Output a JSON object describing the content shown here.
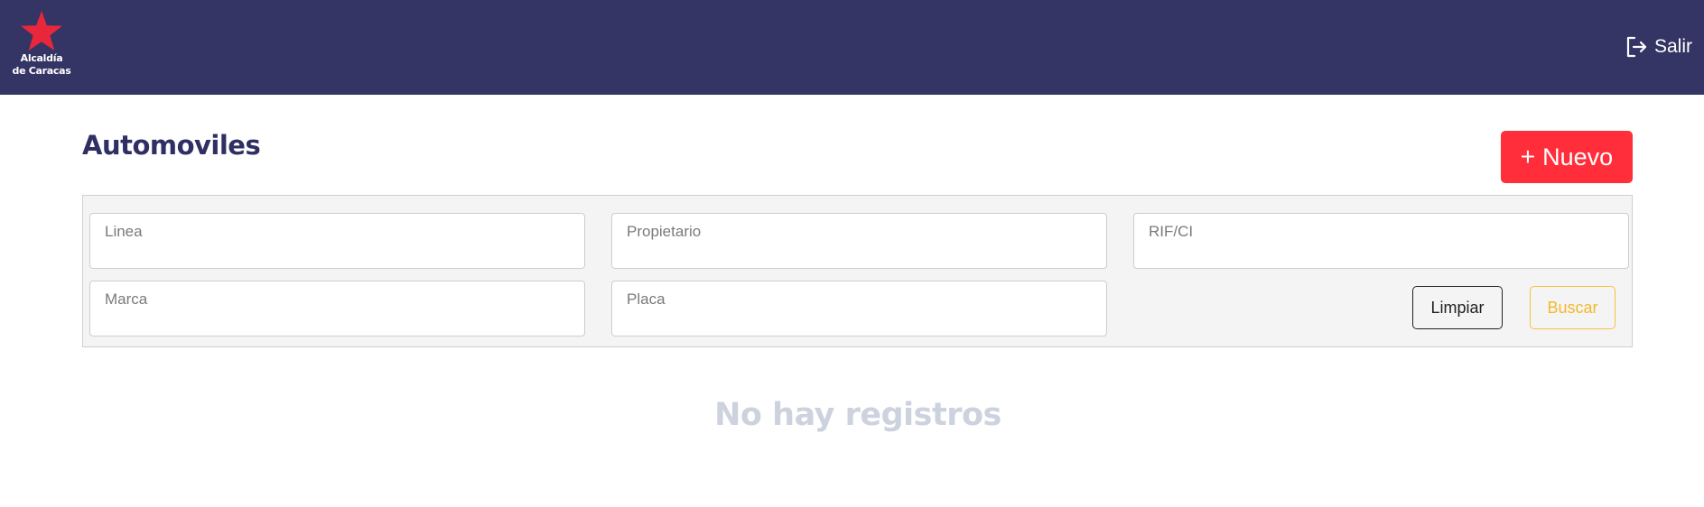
{
  "header": {
    "logo_line1": "Alcaldía",
    "logo_line2": "de Caracas",
    "logout_label": "Salir",
    "colors": {
      "bar": "#343465",
      "star": "#e8283a"
    }
  },
  "page": {
    "title": "Automoviles",
    "new_button_icon": "+",
    "new_button_label": "Nuevo"
  },
  "filters": {
    "linea_placeholder": "Linea",
    "propietario_placeholder": "Propietario",
    "rif_placeholder": "RIF/CI",
    "marca_placeholder": "Marca",
    "placa_placeholder": "Placa",
    "clear_label": "Limpiar",
    "search_label": "Buscar"
  },
  "results": {
    "empty_message": "No hay registros"
  },
  "icons": {
    "logo": "star-icon",
    "logout": "logout-icon"
  }
}
